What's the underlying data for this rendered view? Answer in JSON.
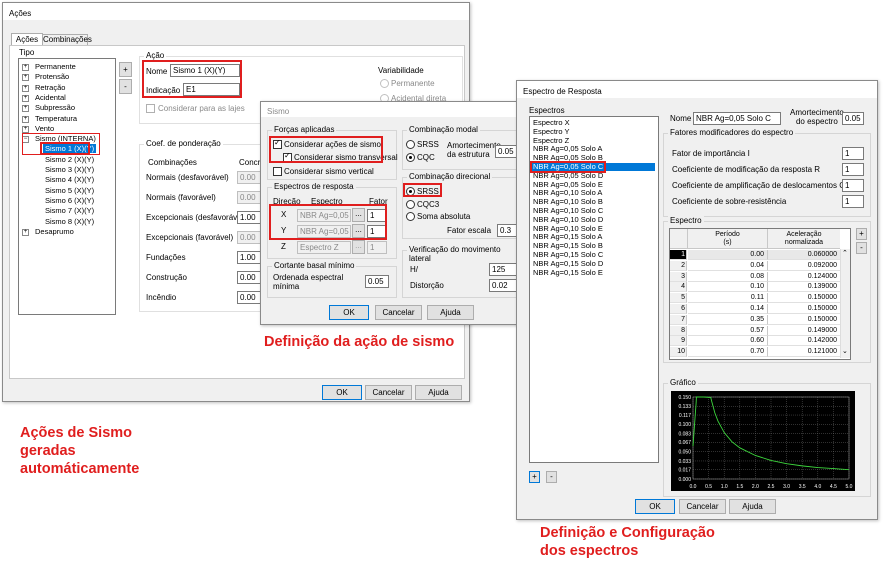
{
  "acoes_window": {
    "title": "Ações",
    "tabs": [
      "Ações",
      "Combinações"
    ],
    "tipo_label": "Tipo",
    "tree": [
      "Permanente",
      "Protensão",
      "Retração",
      "Acidental",
      "Subpressão",
      "Temperatura",
      "Vento",
      "Sismo (INTERNA)",
      "Sismo 1 (X)(Y)",
      "Sismo 2 (X)(Y)",
      "Sismo 3 (X)(Y)",
      "Sismo 4 (X)(Y)",
      "Sismo 5 (X)(Y)",
      "Sismo 6 (X)(Y)",
      "Sismo 7 (X)(Y)",
      "Sismo 8 (X)(Y)",
      "Desaprumo"
    ],
    "side_plus": "+",
    "side_minus": "-",
    "acao_label": "Ação",
    "nome_label": "Nome",
    "nome_value": "Sismo 1 (X)(Y)",
    "indicacao_label": "Indicação",
    "indicacao_value": "E1",
    "variabilidade_label": "Variabilidade",
    "permanente_radio": "Permanente",
    "acidental_radio": "Acidental direta",
    "considerar_lajes": "Considerar para as lajes",
    "coef_label": "Coef. de ponderação",
    "combinacoes_header": "Combinações",
    "concreto_header": "Concre",
    "coef_rows": [
      {
        "label": "Normais (desfavorável)",
        "value": "0.00",
        "enabled": false
      },
      {
        "label": "Normais (favorável)",
        "value": "0.00",
        "enabled": false
      },
      {
        "label": "Excepcionais (desfavorável)",
        "value": "1.00",
        "enabled": true
      },
      {
        "label": "Excepcionais (favorável)",
        "value": "0.00",
        "enabled": false
      },
      {
        "label": "Fundações",
        "value": "1.00",
        "enabled": true
      },
      {
        "label": "Construção",
        "value": "0.00",
        "enabled": true
      },
      {
        "label": "Incêndio",
        "value": "0.00",
        "enabled": true
      }
    ],
    "ok": "OK",
    "cancelar": "Cancelar",
    "ajuda": "Ajuda"
  },
  "sismo_window": {
    "title": "Sismo",
    "forcas_label": "Forças aplicadas",
    "considerar_acoes": "Considerar ações de sismo",
    "considerar_transversal": "Considerar sismo transversal",
    "considerar_vertical": "Considerar sismo vertical",
    "espectros_label": "Espectros de resposta",
    "direcao_header": "Direção",
    "espectro_header": "Espectro",
    "fator_header": "Fator",
    "rows": [
      {
        "dir": "X",
        "espectro": "NBR Ag=0,05",
        "fator": "1"
      },
      {
        "dir": "Y",
        "espectro": "NBR Ag=0,05",
        "fator": "1"
      },
      {
        "dir": "Z",
        "espectro": "Espectro Z",
        "fator": "1"
      }
    ],
    "browse": "...",
    "cortante_label": "Cortante basal mínimo",
    "ordenada_label": "Ordenada espectral\nmínima",
    "ordenada_value": "0.05",
    "comb_modal_label": "Combinação modal",
    "srss": "SRSS",
    "cqc": "CQC",
    "amortecimento_label": "Amortecimento\nda estrutura",
    "amortecimento_value": "0.05",
    "comb_direcional_label": "Combinação direcional",
    "srss2": "SRSS",
    "cqc3": "CQC3",
    "soma_absoluta": "Soma absoluta",
    "fator_escala_label": "Fator escala",
    "fator_escala_value": "0.3",
    "verificacao_label": "Verificação do movimento lateral",
    "h_label": "H/",
    "h_value": "125",
    "distorcao_label": "Distorção",
    "distorcao_value": "0.02",
    "ok": "OK",
    "cancelar": "Cancelar",
    "ajuda": "Ajuda"
  },
  "espectro_window": {
    "title": "Espectro de Resposta",
    "espectros_label": "Espectros",
    "list": [
      "Espectro X",
      "Espectro Y",
      "Espectro Z",
      "NBR Ag=0,05 Solo A",
      "NBR Ag=0,05 Solo B",
      "NBR Ag=0,05 Solo C",
      "NBR Ag=0,05 Solo D",
      "NBR Ag=0,05 Solo E",
      "NBR Ag=0,10 Solo A",
      "NBR Ag=0,10 Solo B",
      "NBR Ag=0,10 Solo C",
      "NBR Ag=0,10 Solo D",
      "NBR Ag=0,10 Solo E",
      "NBR Ag=0,15 Solo A",
      "NBR Ag=0,15 Solo B",
      "NBR Ag=0,15 Solo C",
      "NBR Ag=0,15 Solo D",
      "NBR Ag=0,15 Solo E"
    ],
    "selected_index": 5,
    "list_plus": "+",
    "list_minus": "-",
    "nome_label": "Nome",
    "nome_value": "NBR Ag=0,05 Solo C",
    "amortecimento_label": "Amortecimento\ndo espectro",
    "amortecimento_value": "0.05",
    "fatores_label": "Fatores modificadores do espectro",
    "fatores": [
      {
        "label": "Fator de importância I",
        "value": "1"
      },
      {
        "label": "Coeficiente de modificação da resposta R",
        "value": "1"
      },
      {
        "label": "Coeficiente de amplificação de deslocamentos Cd",
        "value": "1"
      },
      {
        "label": "Coeficiente de sobre-resistência",
        "value": "1"
      }
    ],
    "espectro_label": "Espectro",
    "col_periodo": "Período\n(s)",
    "col_aceleracao": "Aceleração\nnormalizada",
    "table": [
      [
        "1",
        "0.00",
        "0.060000"
      ],
      [
        "2",
        "0.04",
        "0.092000"
      ],
      [
        "3",
        "0.08",
        "0.124000"
      ],
      [
        "4",
        "0.10",
        "0.139000"
      ],
      [
        "5",
        "0.11",
        "0.150000"
      ],
      [
        "6",
        "0.14",
        "0.150000"
      ],
      [
        "7",
        "0.35",
        "0.150000"
      ],
      [
        "8",
        "0.57",
        "0.149000"
      ],
      [
        "9",
        "0.60",
        "0.142000"
      ],
      [
        "10",
        "0.70",
        "0.121000"
      ]
    ],
    "table_plus": "+",
    "table_minus": "-",
    "grafico_label": "Gráfico",
    "ok": "OK",
    "cancelar": "Cancelar",
    "ajuda": "Ajuda"
  },
  "chart_data": {
    "type": "line",
    "x": [
      0.0,
      0.04,
      0.08,
      0.1,
      0.11,
      0.14,
      0.35,
      0.57,
      0.6,
      0.7,
      0.8,
      1.0,
      1.25,
      1.5,
      2.0,
      2.5,
      3.0,
      3.5,
      4.0,
      4.5,
      5.0
    ],
    "y": [
      0.06,
      0.092,
      0.124,
      0.139,
      0.15,
      0.15,
      0.15,
      0.149,
      0.142,
      0.121,
      0.106,
      0.085,
      0.068,
      0.057,
      0.043,
      0.034,
      0.028,
      0.024,
      0.021,
      0.019,
      0.017
    ],
    "xticks": [
      "0.0",
      "0.5",
      "1.0",
      "1.5",
      "2.0",
      "2.5",
      "3.0",
      "3.5",
      "4.0",
      "4.5",
      "5.0"
    ],
    "yticks": [
      "0.150",
      "0.133",
      "0.117",
      "0.100",
      "0.083",
      "0.067",
      "0.050",
      "0.033",
      "0.017",
      "0.000"
    ],
    "xlim": [
      0,
      5
    ],
    "ylim": [
      0,
      0.15
    ],
    "grid": true,
    "colors": {
      "background": "#000000",
      "line": "#3dd63d",
      "grid": "#7a7a7a"
    }
  },
  "captions": {
    "sismo": "Definição da ação de sismo",
    "acoes": "Ações de Sismo\ngeradas\nautomáticamente",
    "espectros": "Definição e Configuração\ndos espectros"
  },
  "colors": {
    "annotation": "#e01e1e",
    "selection": "#0078d7"
  }
}
